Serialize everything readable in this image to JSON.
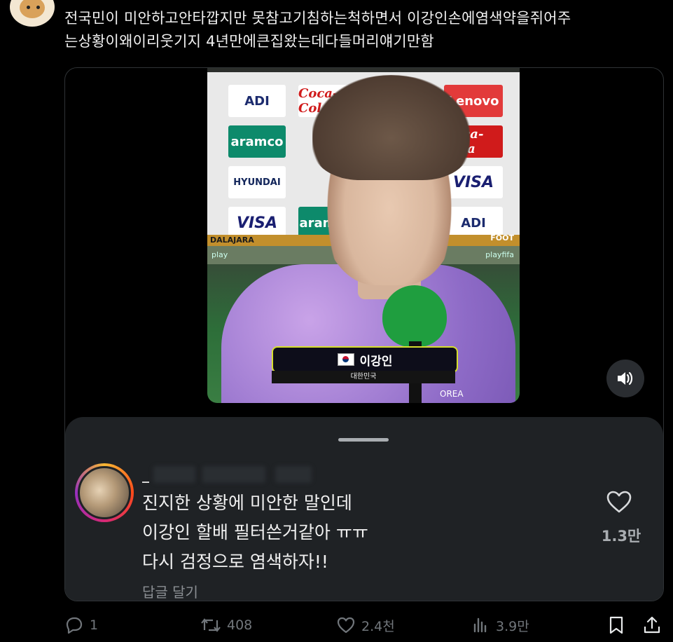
{
  "tweet": {
    "lines": [
      "전국민이  미안하고안타깝지만  못참고기침하는척하면서  이강인손에염색약을쥐어주",
      "는상황이왜이리웃기지  4년만에큰집왔는데다들머리얘기만함"
    ]
  },
  "video": {
    "sponsors": [
      "ADI",
      "Coca-Cola",
      "Lenovo",
      "aramco",
      "HYUNDAI",
      "VISA",
      "Coca-Cola",
      "VISA",
      "aramco",
      "ADI"
    ],
    "banner_text": "DALAJARA",
    "pitch_text": "play",
    "pitch_text_right": "playfifa",
    "footer_text": "FOOT",
    "player_name": "이강인",
    "player_country": "대한민국",
    "kit_text": "OREA"
  },
  "comment": {
    "username": "_",
    "lines": [
      "진지한 상황에 미안한 말인데",
      "이강인 할배 필터쓴거같아 ㅠㅠ",
      "다시 검정으로 염색하자!!"
    ],
    "reply_label": "답글 달기",
    "likes": "1.3만"
  },
  "actions": {
    "replies": "1",
    "retweets": "408",
    "likes": "2.4천",
    "views": "3.9만"
  },
  "colors": {
    "background": "#000000",
    "sheet": "#1f2225",
    "text": "#e7e9ea",
    "muted": "#71767b"
  }
}
